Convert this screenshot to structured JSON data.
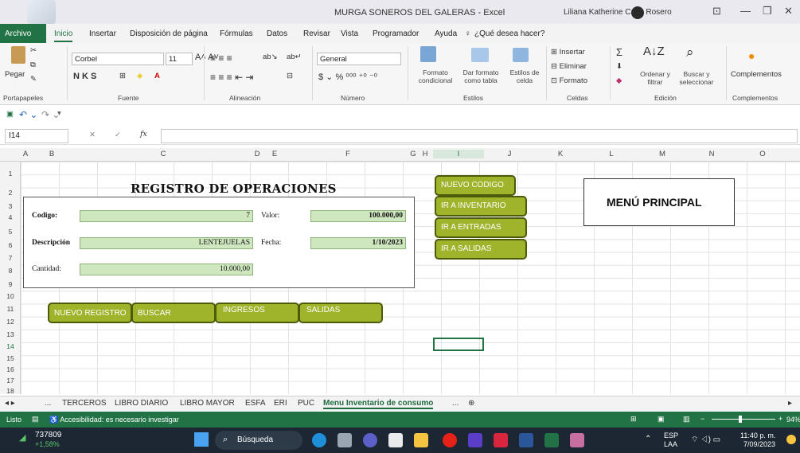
{
  "window": {
    "title": "MURGA SONEROS DEL GALERAS  -  Excel",
    "user": "Liliana Katherine Caez Rosero"
  },
  "tabs": [
    "Archivo",
    "Inicio",
    "Insertar",
    "Disposición de página",
    "Fórmulas",
    "Datos",
    "Revisar",
    "Vista",
    "Programador",
    "Ayuda"
  ],
  "tell_me": "¿Qué desea hacer?",
  "ribbon": {
    "paste": "Pegar",
    "clipboard_group": "Portapapeles",
    "font_name": "Corbel",
    "font_size": "11",
    "font_group": "Fuente",
    "align_group": "Alineación",
    "number_format": "General",
    "number_group": "Número",
    "cond_format": "Formato condicional",
    "as_table": "Dar formato como tabla",
    "cell_styles": "Estilos de celda",
    "styles_group": "Estilos",
    "insert": "Insertar",
    "delete": "Eliminar",
    "format": "Formato",
    "cells_group": "Celdas",
    "sort": "Ordenar y filtrar",
    "find": "Buscar y seleccionar",
    "edit_group": "Edición",
    "addins": "Complementos",
    "addins_group": "Complementos"
  },
  "formula_bar": {
    "name_box": "I14",
    "fx": "fx"
  },
  "columns": [
    "A",
    "B",
    "C",
    "D",
    "E",
    "F",
    "G",
    "H",
    "I",
    "J",
    "K",
    "L",
    "M",
    "N",
    "O"
  ],
  "rows": [
    "1",
    "2",
    "3",
    "4",
    "5",
    "6",
    "7",
    "8",
    "9",
    "10",
    "11",
    "12",
    "13",
    "14",
    "15",
    "16",
    "17",
    "18"
  ],
  "form": {
    "title": "REGISTRO DE OPERACIONES",
    "codigo_label": "Codigo:",
    "codigo_value": "7",
    "valor_label": "Valor:",
    "valor_value": "100.000,00",
    "desc_label": "Descripción",
    "desc_value": "LENTEJUELAS",
    "fecha_label": "Fecha:",
    "fecha_value": "1/10/2023",
    "cantidad_label": "Cantidad:",
    "cantidad_value": "10.000,00"
  },
  "buttons": {
    "nuevo_registro": "NUEVO REGISTRO",
    "buscar": "BUSCAR",
    "ingresos": "INGRESOS",
    "salidas": "SALIDAS",
    "nuevo_codigo": "NUEVO CODIGO",
    "ir_inventario": "IR A INVENTARIO",
    "ir_entradas": "IR A ENTRADAS",
    "ir_salidas": "IR A SALIDAS"
  },
  "menu_principal": "MENÚ PRINCIPAL",
  "sheets": [
    "...",
    "TERCEROS",
    "LIBRO DIARIO",
    "LIBRO MAYOR",
    "ESFA",
    "ERI",
    "PUC",
    "Menu Inventario de consumo",
    "..."
  ],
  "status": {
    "ready": "Listo",
    "accessibility": "Accesibilidad: es necesario investigar",
    "zoom": "94%"
  },
  "taskbar": {
    "stock": "737809",
    "stock_change": "+1,58%",
    "search": "Búsqueda",
    "lang": "ESP",
    "lang2": "LAA",
    "time": "11:40 p. m.",
    "date": "7/09/2023"
  },
  "colors": {
    "excel_green": "#217346",
    "button": "#9fb42a",
    "cell_green": "#cfe7bf"
  }
}
